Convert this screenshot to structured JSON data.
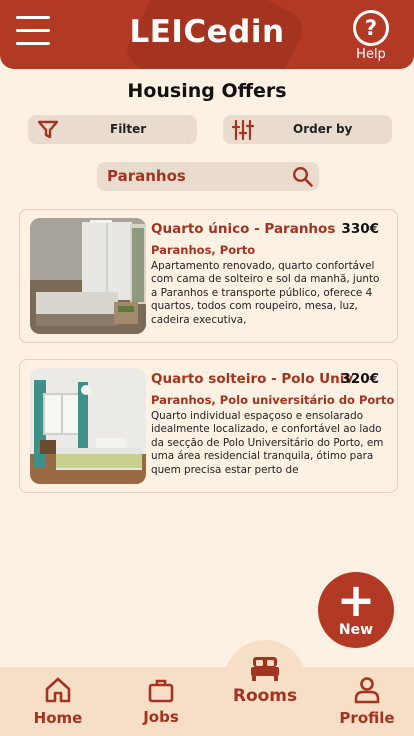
{
  "header": {
    "title": "LEICedin",
    "help_label": "Help"
  },
  "page": {
    "title": "Housing Offers"
  },
  "toolbar": {
    "filter_label": "Filter",
    "order_label": "Order by"
  },
  "search": {
    "value": "Paranhos"
  },
  "offers": [
    {
      "title": "Quarto único - Paranhos",
      "price": "330€",
      "location": "Paranhos, Porto",
      "description": "Apartamento renovado, quarto confortável com cama de solteiro e sol da manhã, junto a Paranhos e transporte público, oferece 4 quartos, todos com roupeiro, mesa, luz, cadeira executiva,"
    },
    {
      "title": "Quarto solteiro - Polo Univ.",
      "price": "320€",
      "location": "Paranhos, Polo universitário do Porto",
      "description": "Quarto individual espaçoso e ensolarado idealmente localizado, e confortável ao lado da secção de Polo Universitário do Porto, em uma área residencial tranquila, ótimo para quem precisa estar perto de"
    }
  ],
  "fab": {
    "label": "New"
  },
  "nav": {
    "home": "Home",
    "jobs": "Jobs",
    "rooms": "Rooms",
    "profile": "Profile"
  },
  "colors": {
    "primary": "#b23a24",
    "background": "#fdf1e4",
    "pill": "#e9dccf",
    "nav": "#f6dfc6"
  }
}
